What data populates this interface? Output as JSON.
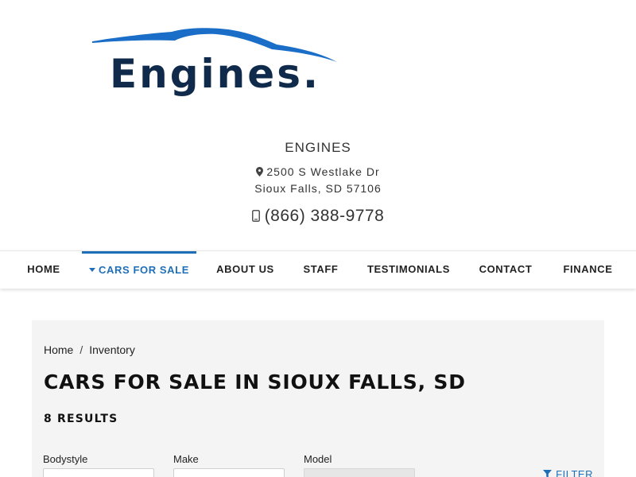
{
  "brand": {
    "logo_text": "Engines.",
    "accent_color": "#1f6fb8",
    "logo_swoosh_color": "#1a6ec8",
    "logo_text_color": "#0f2a4a"
  },
  "dealer": {
    "name": "ENGINES",
    "address_line1": "2500 S Westlake Dr",
    "address_line2": "Sioux Falls, SD 57106",
    "phone": "(866) 388-9778",
    "address_icon": "map-pin-icon",
    "phone_icon": "mobile-phone-icon"
  },
  "nav": {
    "items": [
      {
        "label": "HOME",
        "active": false
      },
      {
        "label": "CARS FOR SALE",
        "active": true
      },
      {
        "label": "ABOUT US",
        "active": false
      },
      {
        "label": "STAFF",
        "active": false
      },
      {
        "label": "TESTIMONIALS",
        "active": false
      },
      {
        "label": "CONTACT",
        "active": false
      },
      {
        "label": "FINANCE",
        "active": false
      }
    ]
  },
  "breadcrumb": {
    "items": [
      "Home",
      "Inventory"
    ],
    "separator": "/"
  },
  "main": {
    "title": "CARS FOR SALE IN SIOUX FALLS, SD",
    "results": "8 RESULTS"
  },
  "filters": {
    "fields": [
      {
        "label": "Bodystyle",
        "value": "",
        "disabled": false
      },
      {
        "label": "Make",
        "value": "",
        "disabled": false
      },
      {
        "label": "Model",
        "value": "",
        "disabled": true
      }
    ],
    "filter_button": "FILTER",
    "filter_icon": "funnel-icon"
  }
}
